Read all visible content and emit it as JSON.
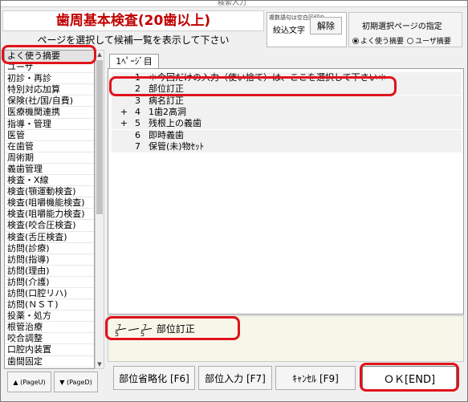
{
  "window": {
    "title": "検索入力"
  },
  "header": {
    "title": "歯周基本検査(20歯以上)",
    "instruction": "ページを選択して候補一覧を表示して下さい"
  },
  "keyword": {
    "hint": "複数語句は空白区切り",
    "label": "絞込文字",
    "value": "",
    "clear_label": "解除"
  },
  "initial_page": {
    "label": "初期選択ページの指定",
    "options": [
      {
        "label": "よく使う摘要",
        "selected": true
      },
      {
        "label": "ユーザ摘要",
        "selected": false
      }
    ]
  },
  "categories": [
    "よく使う摘要",
    "ユーザ",
    "初診・再診",
    "特別対応加算",
    "保険(社/国/自費)",
    "医療機関連携",
    "指導・管理",
    "医管",
    "在歯管",
    "周術期",
    "義歯管理",
    "検査・X線",
    "検査(顎運動検査)",
    "検査(咀嚼機能検査)",
    "検査(咀嚼能力検査)",
    "検査(咬合圧検査)",
    "検査(舌圧検査)",
    "訪問(診療)",
    "訪問(指導)",
    "訪問(理由)",
    "訪問(介護)",
    "訪問(口腔リハ)",
    "訪問(ＮＳＴ)",
    "投薬・処方",
    "根管治療",
    "咬合調整",
    "口腔内装置",
    "歯間固定"
  ],
  "pager": {
    "up_label": "▲ (PageU)",
    "down_label": "▼ (PageD)"
  },
  "tabs": [
    {
      "label": "1ﾍﾟｰｼﾞ目"
    }
  ],
  "rows": [
    {
      "mark": "",
      "num": "1",
      "text": "＊今回だけの入力（使い捨て）は、ここを選択して下さい＊"
    },
    {
      "mark": "",
      "num": "2",
      "text": "部位訂正"
    },
    {
      "mark": "",
      "num": "3",
      "text": "病名訂正"
    },
    {
      "mark": "+",
      "num": "4",
      "text": "1歯2高洞"
    },
    {
      "mark": "+",
      "num": "5",
      "text": "残根上の義歯"
    },
    {
      "mark": "",
      "num": "6",
      "text": "即時義歯"
    },
    {
      "mark": "",
      "num": "7",
      "text": "保管(未)物ｾｯﾄ"
    }
  ],
  "result": {
    "teeth": [
      {
        "top": "7",
        "bottom": "5"
      },
      {
        "top": "",
        "bottom": ""
      },
      {
        "top": "7",
        "bottom": "5"
      }
    ],
    "text": "部位訂正"
  },
  "buttons": {
    "abbrev": "部位省略化 [F6]",
    "site_input": "部位入力 [F7]",
    "cancel": "ｷｬﾝｾﾙ [F9]",
    "ok": "ＯＫ[END]"
  },
  "colors": {
    "title_red": "#c00000",
    "highlight": "#e0131b",
    "result_bg": "#f7f7e9"
  }
}
